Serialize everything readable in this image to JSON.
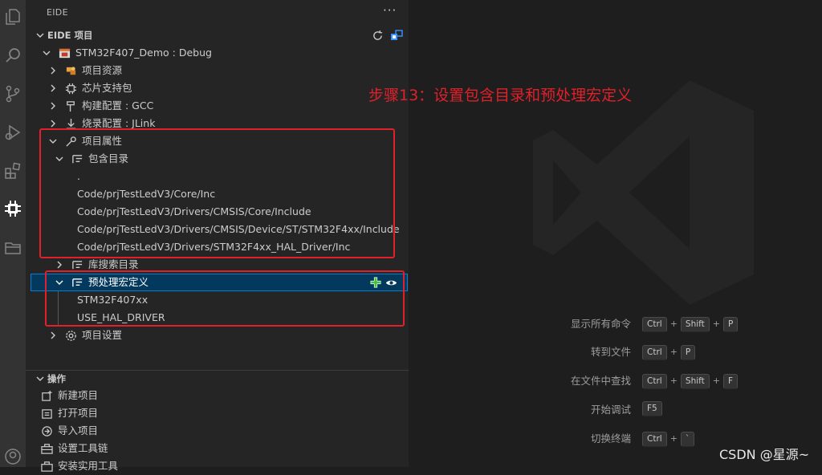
{
  "sidebar": {
    "header": "EIDE",
    "more": "···",
    "section_title": "EIDE 项目",
    "project": "STM32F407_Demo : Debug",
    "items": {
      "resources": "项目资源",
      "chip": "芯片支持包",
      "build": "构建配置 : GCC",
      "flash": "烧录配置 : JLink",
      "props": "项目属性",
      "include": "包含目录",
      "libsearch": "库搜索目录",
      "macros": "预处理宏定义",
      "settings": "项目设置"
    },
    "include_dirs": [
      ".",
      "Code/prjTestLedV3/Core/Inc",
      "Code/prjTestLedV3/Drivers/CMSIS/Core/Include",
      "Code/prjTestLedV3/Drivers/CMSIS/Device/ST/STM32F4xx/Include",
      "Code/prjTestLedV3/Drivers/STM32F4xx_HAL_Driver/Inc"
    ],
    "macros": [
      "STM32F407xx",
      "USE_HAL_DRIVER"
    ],
    "ops_title": "操作",
    "ops": [
      "新建项目",
      "打开项目",
      "导入项目",
      "设置工具链",
      "安装实用工具"
    ]
  },
  "annotation": "步骤13：设置包含目录和预处理宏定义",
  "shortcuts": [
    {
      "label": "显示所有命令",
      "keys": [
        "Ctrl",
        "Shift",
        "P"
      ]
    },
    {
      "label": "转到文件",
      "keys": [
        "Ctrl",
        "P"
      ]
    },
    {
      "label": "在文件中查找",
      "keys": [
        "Ctrl",
        "Shift",
        "F"
      ]
    },
    {
      "label": "开始调试",
      "keys": [
        "F5"
      ]
    },
    {
      "label": "切换终端",
      "keys": [
        "Ctrl",
        "`"
      ]
    }
  ],
  "watermark": "CSDN @星源~",
  "colors": {
    "accent": "#007fd4",
    "annotation": "#e0202a",
    "selection": "#04395e"
  }
}
